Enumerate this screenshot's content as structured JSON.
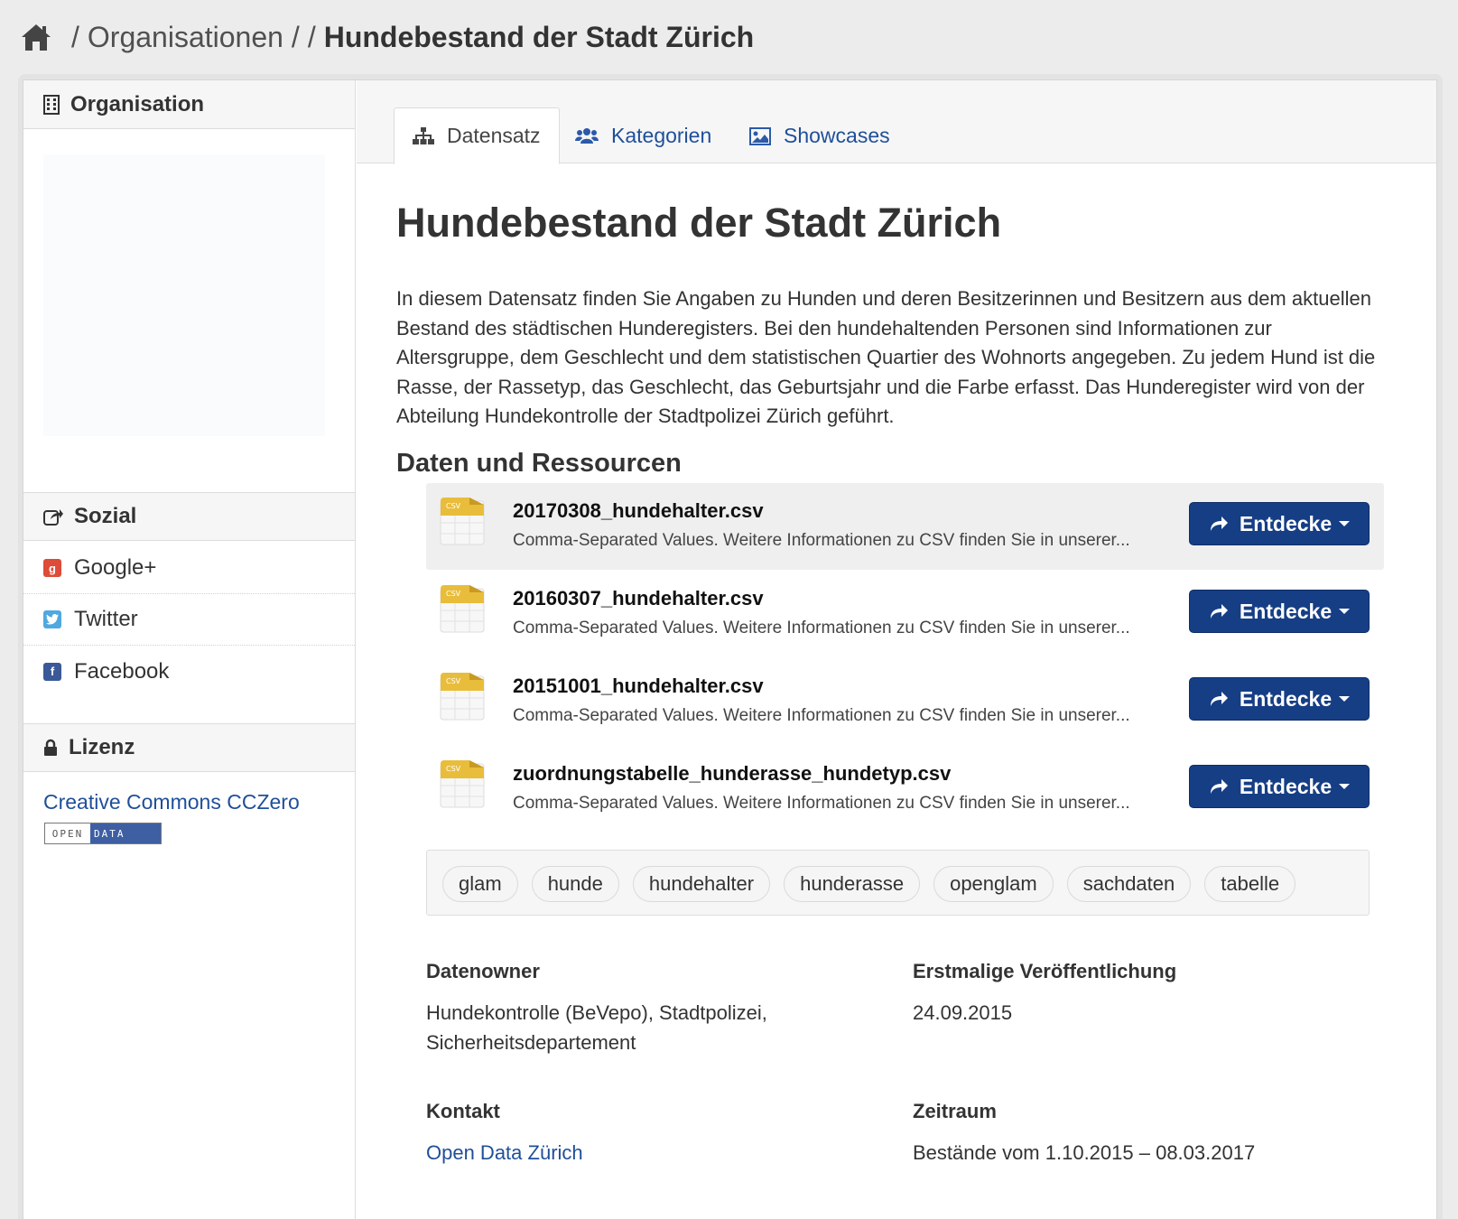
{
  "breadcrumb": {
    "separator": "/",
    "organisations": "Organisationen",
    "current": "Hundebestand der Stadt Zürich"
  },
  "sidebar": {
    "organisation_heading": "Organisation",
    "sozial_heading": "Sozial",
    "social": [
      {
        "label": "Google+",
        "icon": "google-plus-icon",
        "color": "#dd4b39"
      },
      {
        "label": "Twitter",
        "icon": "twitter-icon",
        "color": "#4fa8e0"
      },
      {
        "label": "Facebook",
        "icon": "facebook-icon",
        "color": "#3b5998"
      }
    ],
    "lizenz_heading": "Lizenz",
    "license_link": "Creative Commons CCZero",
    "badge_left": "OPEN",
    "badge_right": "DATA"
  },
  "tabs": [
    {
      "label": "Datensatz",
      "icon": "sitemap-icon",
      "active": true
    },
    {
      "label": "Kategorien",
      "icon": "users-icon",
      "active": false
    },
    {
      "label": "Showcases",
      "icon": "picture-icon",
      "active": false
    }
  ],
  "dataset": {
    "title": "Hundebestand der Stadt Zürich",
    "description": "In diesem Datensatz finden Sie Angaben zu Hunden und deren Besitzerinnen und Besitzern aus dem aktuellen Bestand des städtischen Hunderegisters. Bei den hundehaltenden Personen sind Informationen zur Altersgruppe, dem Geschlecht und dem statistischen Quartier des Wohnorts angegeben. Zu jedem Hund ist die Rasse, der Rassetyp, das Geschlecht, das Geburtsjahr und die Farbe erfasst. Das Hunderegister wird von der Abteilung Hundekontrolle der Stadtpolizei Zürich geführt."
  },
  "resources_heading": "Daten und Ressourcen",
  "resources": [
    {
      "name": "20170308_hundehalter.csv",
      "desc": "Comma-Separated Values. Weitere Informationen zu CSV finden Sie in unserer...",
      "format": "CSV",
      "button": "Entdecke"
    },
    {
      "name": "20160307_hundehalter.csv",
      "desc": "Comma-Separated Values. Weitere Informationen zu CSV finden Sie in unserer...",
      "format": "CSV",
      "button": "Entdecke"
    },
    {
      "name": "20151001_hundehalter.csv",
      "desc": "Comma-Separated Values. Weitere Informationen zu CSV finden Sie in unserer...",
      "format": "CSV",
      "button": "Entdecke"
    },
    {
      "name": "zuordnungstabelle_hunderasse_hundetyp.csv",
      "desc": "Comma-Separated Values. Weitere Informationen zu CSV finden Sie in unserer...",
      "format": "CSV",
      "button": "Entdecke"
    }
  ],
  "tags": [
    "glam",
    "hunde",
    "hundehalter",
    "hunderasse",
    "openglam",
    "sachdaten",
    "tabelle"
  ],
  "meta": {
    "datenowner_label": "Datenowner",
    "datenowner_value": "Hundekontrolle (BeVepo), Stadtpolizei, Sicherheitsdepartement",
    "erstmalige_label": "Erstmalige Veröffentlichung",
    "erstmalige_value": "24.09.2015",
    "kontakt_label": "Kontakt",
    "kontakt_value": "Open Data Zürich",
    "zeitraum_label": "Zeitraum",
    "zeitraum_value": "Bestände vom 1.10.2015 – 08.03.2017"
  },
  "colors": {
    "link": "#1f4f99",
    "button": "#163e85",
    "csv_icon": "#e9bd3c"
  }
}
